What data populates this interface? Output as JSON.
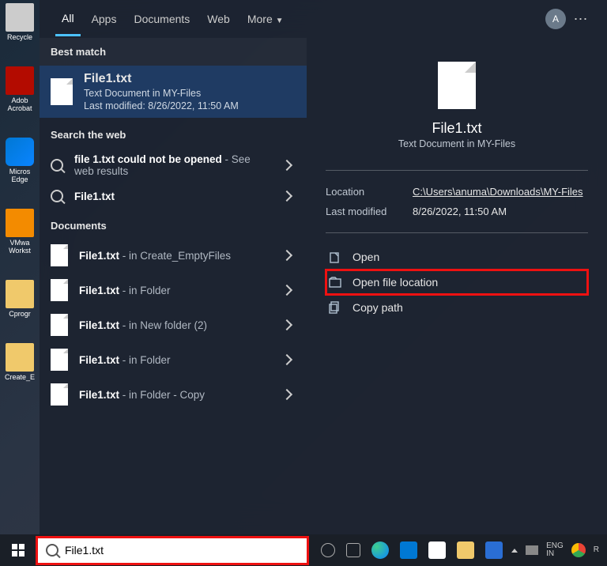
{
  "desktop_icons": [
    "Recycle",
    "Adob Acrobat",
    "Micros Edge",
    "VMwa Workst",
    "Cprogr",
    "Create_E"
  ],
  "tabs": {
    "all": "All",
    "apps": "Apps",
    "documents": "Documents",
    "web": "Web",
    "more": "More"
  },
  "avatar_initial": "A",
  "sections": {
    "best_match": "Best match",
    "search_web": "Search the web",
    "documents": "Documents"
  },
  "best": {
    "name": "File1.txt",
    "subtitle": "Text Document in MY-Files",
    "modified_label": "Last modified: 8/26/2022, 11:50 AM"
  },
  "web": [
    {
      "name": "file 1.txt could not be opened",
      "suffix": " - See web results"
    },
    {
      "name": "File1.txt",
      "suffix": ""
    }
  ],
  "documents": [
    {
      "name": "File1.txt",
      "suffix": " - in Create_EmptyFiles"
    },
    {
      "name": "File1.txt",
      "suffix": " - in Folder"
    },
    {
      "name": "File1.txt",
      "suffix": " - in New folder (2)"
    },
    {
      "name": "File1.txt",
      "suffix": " - in Folder"
    },
    {
      "name": "File1.txt",
      "suffix": " - in Folder - Copy"
    }
  ],
  "preview": {
    "name": "File1.txt",
    "subtitle": "Text Document in MY-Files",
    "location_label": "Location",
    "location_value": "C:\\Users\\anuma\\Downloads\\MY-Files",
    "modified_label": "Last modified",
    "modified_value": "8/26/2022, 11:50 AM",
    "actions": {
      "open": "Open",
      "open_location": "Open file location",
      "copy_path": "Copy path"
    }
  },
  "search_value": "File1.txt",
  "tray": {
    "lang": "ENG\nIN",
    "indicator": "R"
  }
}
